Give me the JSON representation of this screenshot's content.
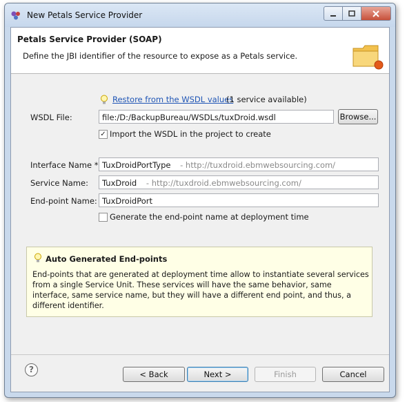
{
  "window": {
    "title": "New Petals Service Provider"
  },
  "header": {
    "title": "Petals Service Provider (SOAP)",
    "description": "Define the JBI identifier of the resource to expose as a Petals service."
  },
  "restore": {
    "link_text": "Restore from the WSDL values",
    "suffix": "(1 service available)"
  },
  "wsdl": {
    "label": "WSDL File:",
    "value": "file:/D:/BackupBureau/WSDLs/tuxDroid.wsdl",
    "browse_label": "Browse...",
    "import_label": "Import the WSDL in the project to create",
    "import_checked": true
  },
  "interface": {
    "label": "Interface Name *:",
    "name": "TuxDroidPortType",
    "namespace": "-  http://tuxdroid.ebmwebsourcing.com/"
  },
  "service": {
    "label": "Service Name:",
    "name": "TuxDroid",
    "namespace": "-  http://tuxdroid.ebmwebsourcing.com/"
  },
  "endpoint": {
    "label": "End-point Name:",
    "value": "TuxDroidPort",
    "generate_label": "Generate the end-point name at deployment time",
    "generate_checked": false
  },
  "info": {
    "title": "Auto Generated End-points",
    "text": "End-points that are generated at deployment time allow to instantiate several services from a single Service Unit. These services will have the same behavior, same interface, same service name, but they will have a different end point, and thus, a different identifier."
  },
  "footer": {
    "help_symbol": "?",
    "back_label": "< Back",
    "next_label": "Next >",
    "finish_label": "Finish",
    "cancel_label": "Cancel"
  },
  "colors": {
    "link": "#1f55b5",
    "info_background": "#ffffe6",
    "titlebar": "#c9d9ec"
  },
  "icons": [
    "petals-app-icon",
    "minimize-icon",
    "maximize-icon",
    "close-icon",
    "folder-wizard-icon",
    "lightbulb-icon",
    "help-icon"
  ]
}
